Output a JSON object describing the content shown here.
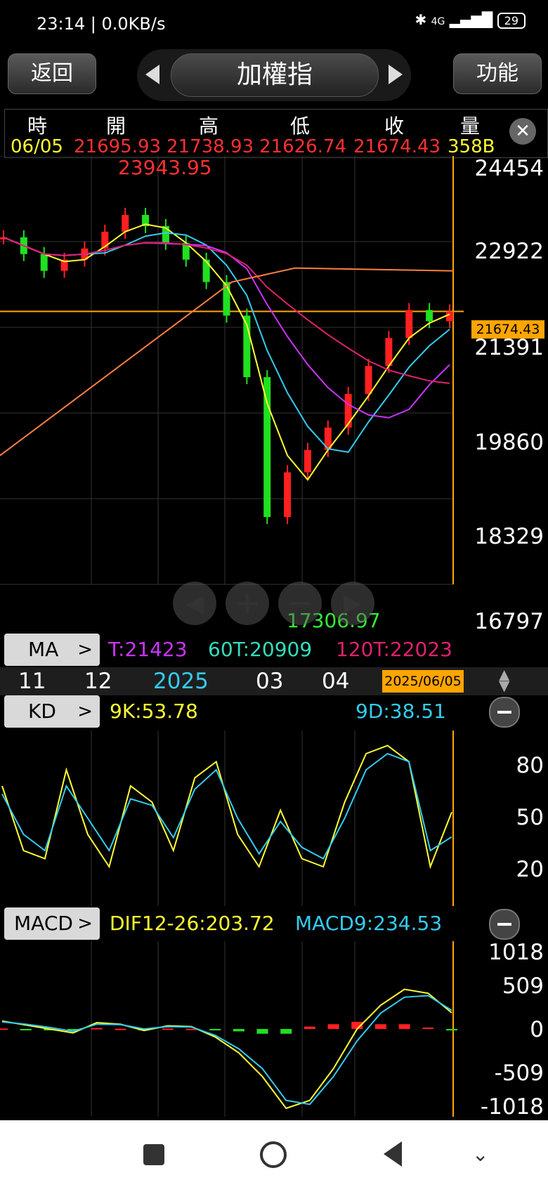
{
  "status": {
    "time": "23:14 | 0.0KB/s",
    "battery": "29",
    "network": "4G"
  },
  "header": {
    "back_label": "返回",
    "title": "加權指",
    "func_label": "功能"
  },
  "quote": {
    "headers": [
      "時",
      "開",
      "高",
      "低",
      "收",
      "量"
    ],
    "values": [
      "06/05",
      "21695.93",
      "21738.93",
      "21626.74",
      "21674.43",
      "358B"
    ]
  },
  "price_axis": [
    "24454",
    "22922",
    "21391",
    "19860",
    "18329",
    "16797"
  ],
  "current_price_tag": "21674.43",
  "high_annotation": "23943.95",
  "low_annotation": "17306.97",
  "ma_bar": {
    "label": "MA",
    "items": [
      "T:21423",
      "60T:20909",
      "120T:22023"
    ]
  },
  "time_axis": [
    "11",
    "12",
    "2025",
    "03",
    "04"
  ],
  "cursor_date": "2025/06/05",
  "kd_bar": {
    "label": "KD",
    "k": "9K:53.78",
    "d": "9D:38.51"
  },
  "kd_axis": [
    "80",
    "50",
    "20"
  ],
  "macd_bar": {
    "label": "MACD",
    "dif": "DIF12-26:203.72",
    "macd": "MACD9:234.53"
  },
  "macd_axis": [
    "1018",
    "509",
    "0",
    "-509",
    "-1018"
  ],
  "colors": {
    "up": "#ff2020",
    "down": "#20e020",
    "yellow": "#ffff33",
    "cyan": "#33ccee",
    "purple": "#cc33ff",
    "orange": "#ff7f3f",
    "pink": "#e0206f",
    "teal": "#33ddbb"
  },
  "chart_data": [
    {
      "type": "line",
      "title": "",
      "series": [
        {
          "name": "",
          "values": [
            23000,
            22700,
            22400,
            22600,
            22800,
            23100,
            23400,
            23200,
            22900,
            22600,
            22200,
            21600,
            20500,
            18000,
            18800,
            19200,
            19600,
            20200,
            20700,
            21200,
            21700,
            21500,
            21674
          ]
        }
      ],
      "ylim": [
        16797,
        24454
      ],
      "high": 23943.95,
      "low": 17306.97
    },
    {
      "type": "line",
      "series": [
        {
          "name": "9K",
          "values": [
            70,
            30,
            25,
            80,
            40,
            20,
            70,
            60,
            30,
            75,
            85,
            40,
            20,
            55,
            25,
            20,
            60,
            90,
            95,
            85,
            20,
            53.78
          ]
        },
        {
          "name": "9D",
          "values": [
            65,
            40,
            30,
            70,
            50,
            30,
            62,
            58,
            38,
            68,
            80,
            50,
            28,
            48,
            32,
            25,
            50,
            80,
            90,
            85,
            30,
            38.51
          ]
        }
      ],
      "ylim": [
        0,
        100
      ]
    },
    {
      "type": "bar",
      "series": [
        {
          "name": "DIF12-26",
          "values": [
            100,
            50,
            0,
            -50,
            80,
            60,
            -20,
            40,
            30,
            -100,
            -300,
            -600,
            -1000,
            -900,
            -500,
            0,
            300,
            500,
            450,
            203.72
          ]
        },
        {
          "name": "MACD9",
          "values": [
            90,
            60,
            20,
            -30,
            60,
            55,
            0,
            30,
            25,
            -80,
            -250,
            -500,
            -900,
            -950,
            -600,
            -150,
            200,
            400,
            420,
            234.53
          ]
        }
      ],
      "ylim": [
        -1018,
        1018
      ]
    }
  ]
}
